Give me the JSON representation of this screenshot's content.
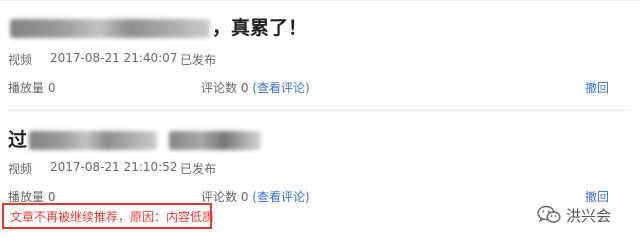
{
  "item1": {
    "title_prefix": "",
    "title_suffix": "，真累了！",
    "type": "视频",
    "datetime": "2017-08-21 21:40:07",
    "status": "已发布",
    "plays": "播放量 0",
    "comments": "评论数 0",
    "comment_link": "(查看评论)",
    "revoke": "撤回"
  },
  "item2": {
    "title_prefix": "过",
    "type": "视频",
    "datetime": "2017-08-21 21:10:52",
    "status": "已发布",
    "plays": "播放量 0",
    "comments": "评论数 0",
    "comment_link": "(查看评论)",
    "revoke": "撤回"
  },
  "notice": "文章不再被继续推荐，原因：内容低质",
  "watermark": {
    "icon": "wechat-icon",
    "text": "洪兴会"
  },
  "colors": {
    "link": "#3a6fd0",
    "notice_red": "#e53935",
    "meta_text": "#666666"
  }
}
